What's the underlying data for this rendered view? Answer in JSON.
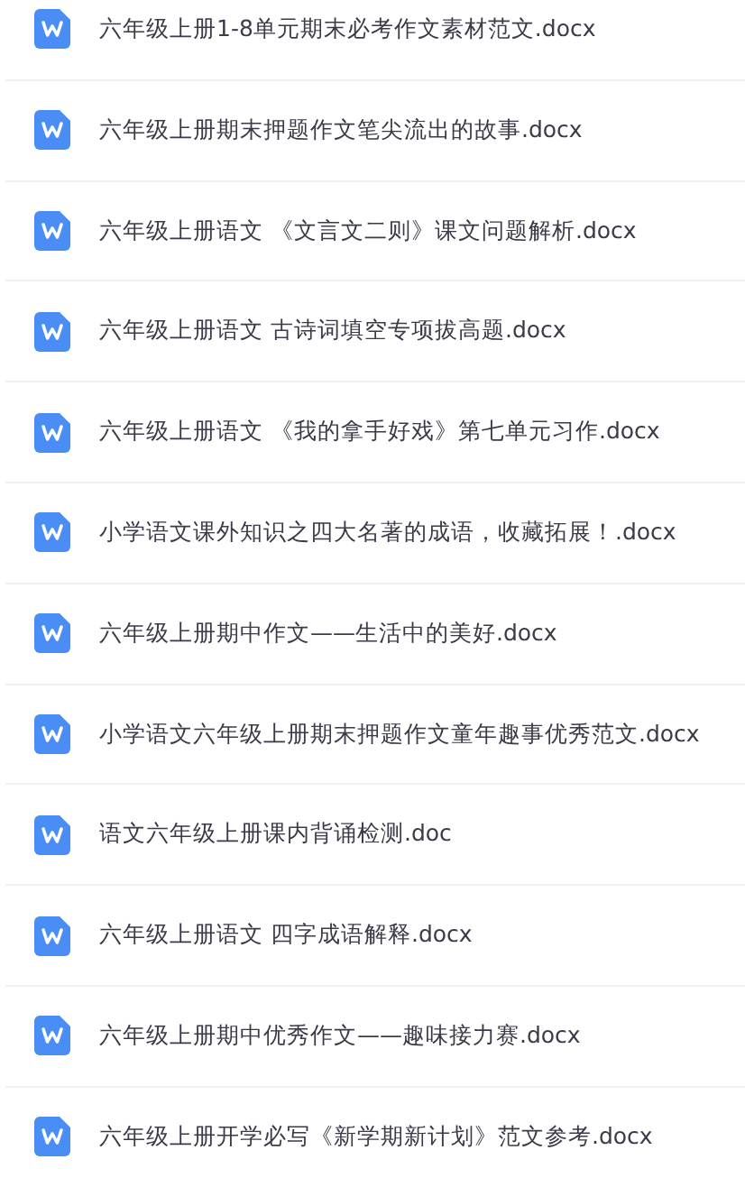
{
  "files": [
    {
      "name": "六年级上册1-8单元期末必考作文素材范文.docx"
    },
    {
      "name": "六年级上册期末押题作文笔尖流出的故事.docx"
    },
    {
      "name": "六年级上册语文 《文言文二则》课文问题解析.docx"
    },
    {
      "name": "六年级上册语文 古诗词填空专项拔高题.docx"
    },
    {
      "name": "六年级上册语文 《我的拿手好戏》第七单元习作.docx"
    },
    {
      "name": "小学语文课外知识之四大名著的成语，收藏拓展！.docx"
    },
    {
      "name": "六年级上册期中作文——生活中的美好.docx"
    },
    {
      "name": "小学语文六年级上册期末押题作文童年趣事优秀范文.docx"
    },
    {
      "name": "语文六年级上册课内背诵检测.doc"
    },
    {
      "name": "六年级上册语文 四字成语解释.docx"
    },
    {
      "name": "六年级上册期中优秀作文——趣味接力赛.docx"
    },
    {
      "name": "六年级上册开学必写《新学期新计划》范文参考.docx"
    }
  ]
}
